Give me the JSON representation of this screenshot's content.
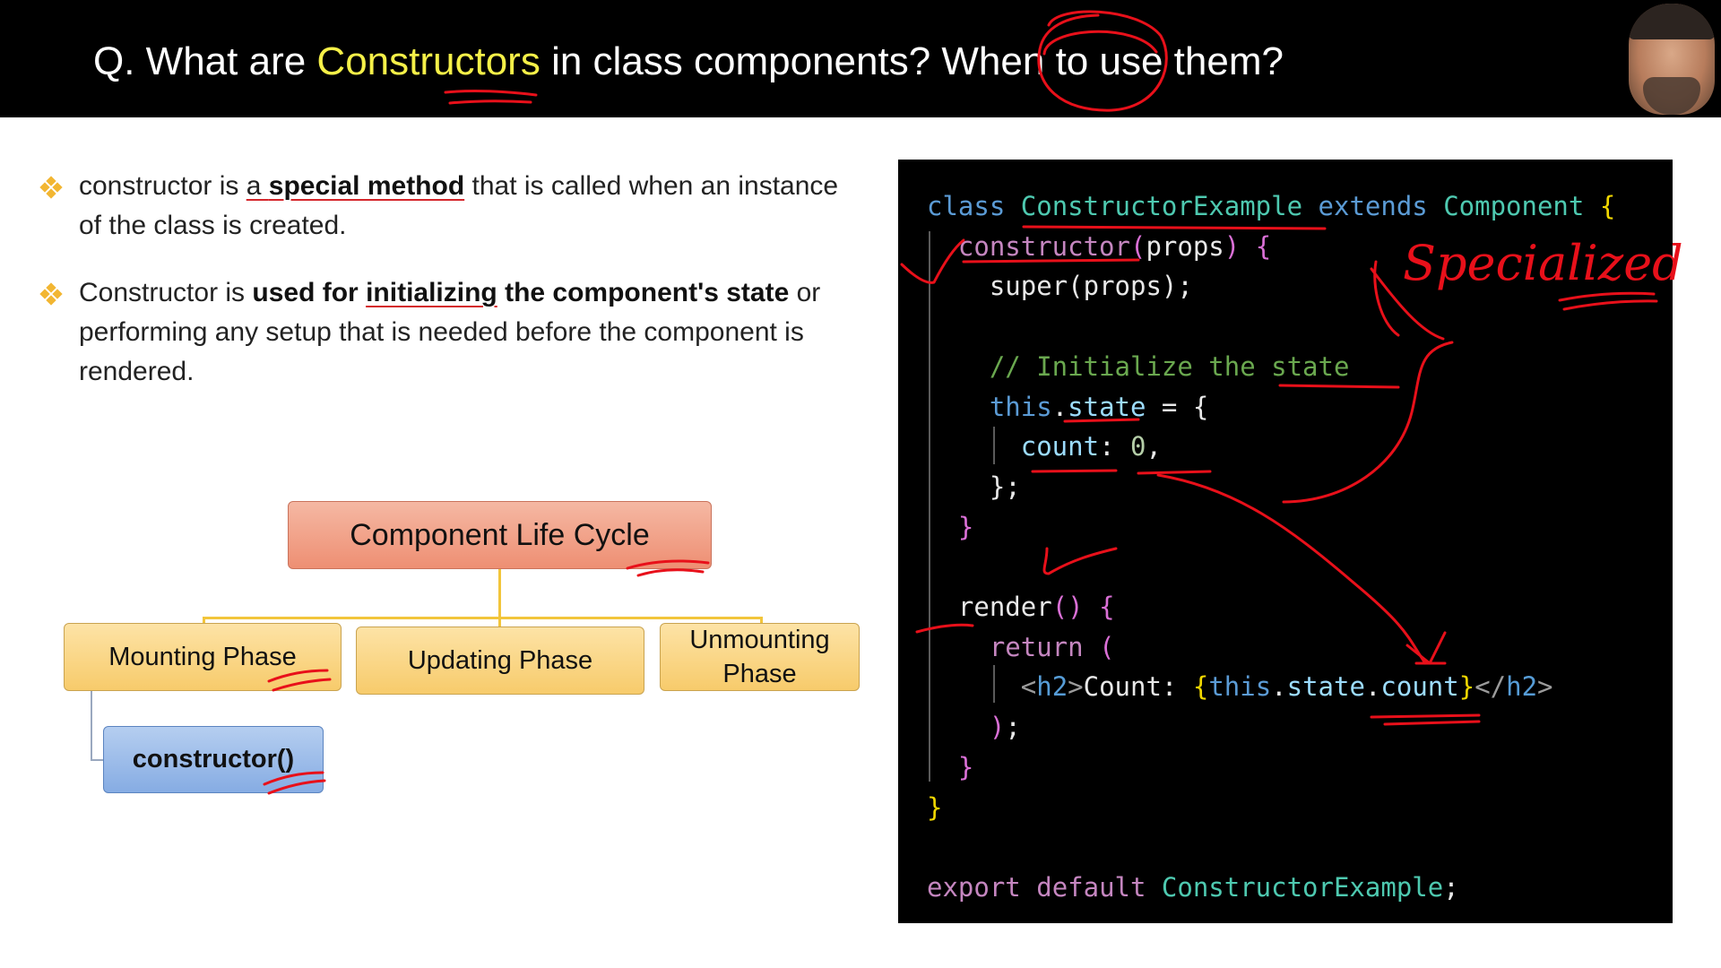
{
  "header": {
    "title_prefix": "Q. What are ",
    "title_highlight": "Constructors",
    "title_suffix": " in class components? When to use them?",
    "highlight_color": "#f5f048"
  },
  "bullets": [
    {
      "icon": "diamond-bullet-icon",
      "p1": "constructor is ",
      "p2": "a ",
      "p3": "special method",
      "p4": " that is called when an instance of the class is created."
    },
    {
      "icon": "diamond-bullet-icon",
      "p1": "Constructor is ",
      "p2": "used for ",
      "p3": "initializing",
      "p4": " the component's state",
      "p5": " or performing any setup that is needed before the component is rendered."
    }
  ],
  "diagram": {
    "root": "Component Life Cycle",
    "phases": [
      "Mounting Phase",
      "Updating Phase",
      "Unmounting Phase"
    ],
    "child": "constructor()"
  },
  "code": {
    "lines": [
      "class ConstructorExample extends Component {",
      "  constructor(props) {",
      "    super(props);",
      "",
      "    // Initialize the state",
      "    this.state = {",
      "      count: 0,",
      "    };",
      "  }",
      "",
      "  render() {",
      "    return (",
      "      <h2>Count: {this.state.count}</h2>",
      "    );",
      "  }",
      "}",
      "",
      "export default ConstructorExample;"
    ]
  },
  "annotation": {
    "handwritten": "Specialized",
    "ink_color": "#e8101a"
  }
}
